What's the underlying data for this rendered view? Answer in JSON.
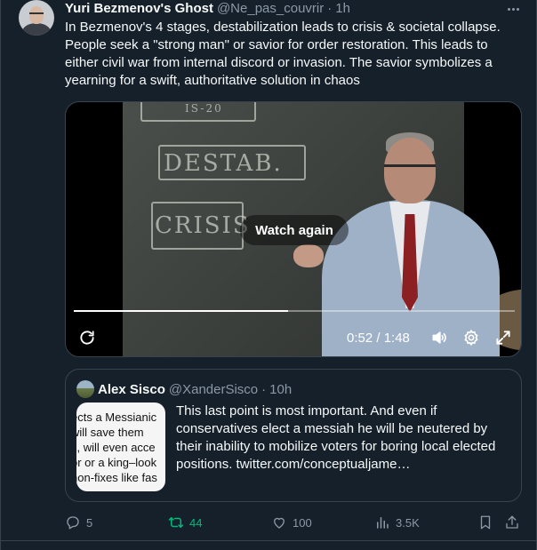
{
  "tweet": {
    "author_name": "Yuri Bezmenov's Ghost",
    "author_handle": "@Ne_pas_couvrir",
    "separator": "·",
    "time_ago": "1h",
    "text": "In Bezmenov's 4 stages, destabilization leads to crisis & societal collapse. People seek a \"strong man\" or savior for order restoration. This leads to either civil war from internal discord or invasion. The savior symbolizes a yearning for a swift, authoritative solution in chaos"
  },
  "video": {
    "chalk_top": "IS-20",
    "chalk_destab": "DESTAB.",
    "chalk_crisis": "CRISIS",
    "overlay_label": "Watch again",
    "time_display": "0:52 / 1:48",
    "progress_fraction": 0.485
  },
  "quote": {
    "author_name": "Alex Sisco",
    "author_handle": "@XanderSisco",
    "separator": "·",
    "time_ago": "10h",
    "text": "This last point is most important. And even if conservatives elect a messiah he will be neutered by their inability to mobilize voters for boring local elected positions.  twitter.com/conceptualjame…",
    "thumbnail_lines": [
      "ects a Messianic",
      "will save them",
      "s, will even acce",
      "or or a king–look",
      "non-fixes like fas"
    ]
  },
  "actions": {
    "replies": "5",
    "retweets": "44",
    "likes": "100",
    "views": "3.5K"
  },
  "colors": {
    "background": "#15202b",
    "border": "#38444d",
    "text_primary": "#f7f9f9",
    "text_secondary": "#8b98a5",
    "retweet_active": "#00ba7c"
  },
  "icons": [
    "more-icon",
    "replay-icon",
    "volume-icon",
    "settings-icon",
    "fullscreen-icon",
    "reply-icon",
    "retweet-icon",
    "like-icon",
    "views-icon",
    "bookmark-icon",
    "share-icon"
  ]
}
